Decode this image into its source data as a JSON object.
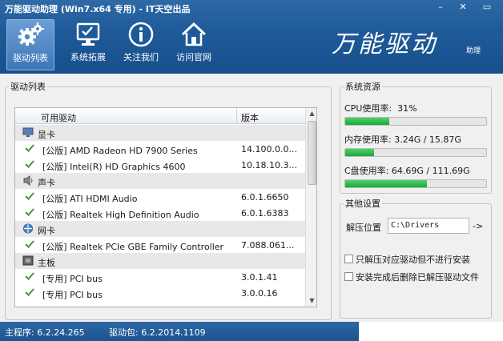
{
  "window": {
    "title": "万能驱动助理 (Win7.x64 专用) - IT天空出品",
    "min_glyph": "–",
    "close_glyph": "✕",
    "max_glyph": "▭"
  },
  "toolbar": {
    "items": [
      {
        "label": "驱动列表",
        "icon": "gear-icon",
        "active": true
      },
      {
        "label": "系统拓展",
        "icon": "monitor-icon",
        "active": false
      },
      {
        "label": "关注我们",
        "icon": "info-icon",
        "active": false
      },
      {
        "label": "访问官网",
        "icon": "home-icon",
        "active": false
      }
    ]
  },
  "brand": {
    "name": "万能驱动",
    "suffix": "助理"
  },
  "driver_panel": {
    "title": "驱动列表",
    "columns": {
      "name": "可用驱动",
      "version": "版本"
    },
    "rows": [
      {
        "type": "category",
        "name": "显卡",
        "icon": "display-card-icon"
      },
      {
        "type": "driver",
        "name": "[公版] AMD Radeon HD 7900 Series",
        "version": "14.100.0.0..."
      },
      {
        "type": "driver",
        "name": "[公版] Intel(R) HD Graphics 4600",
        "version": "10.18.10.3..."
      },
      {
        "type": "category",
        "name": "声卡",
        "icon": "speaker-icon"
      },
      {
        "type": "driver",
        "name": "[公版] ATI HDMI Audio",
        "version": "6.0.1.6650"
      },
      {
        "type": "driver",
        "name": "[公版] Realtek High Definition Audio",
        "version": "6.0.1.6383"
      },
      {
        "type": "category",
        "name": "网卡",
        "icon": "network-icon"
      },
      {
        "type": "driver",
        "name": "[公版] Realtek PCIe GBE Family Controller",
        "version": "7.088.061..."
      },
      {
        "type": "category",
        "name": "主板",
        "icon": "motherboard-icon"
      },
      {
        "type": "driver",
        "name": "[专用] PCI bus",
        "version": "3.0.1.41"
      },
      {
        "type": "driver",
        "name": "[专用] PCI bus",
        "version": "3.0.0.16"
      }
    ]
  },
  "system_resources": {
    "title": "系统资源",
    "cpu": {
      "label": "CPU使用率:",
      "value": "31%",
      "fraction": 0.31
    },
    "memory": {
      "label": "内存使用率:",
      "value": "3.24G / 15.87G",
      "fraction": 0.204
    },
    "disk": {
      "label": "C盘使用率:",
      "value": "64.69G / 111.69G",
      "fraction": 0.579
    }
  },
  "other_settings": {
    "title": "其他设置",
    "unzip_label": "解压位置",
    "unzip_path": "C:\\Drivers",
    "go_label": "->",
    "options": [
      {
        "label": "只解压对应驱动但不进行安装",
        "checked": false
      },
      {
        "label": "安装完成后删除已解压驱动文件",
        "checked": false
      }
    ]
  },
  "status": {
    "main_program": "主程序: 6.2.24.265",
    "driver_pack": "驱动包: 6.2.2014.1109"
  },
  "colors": {
    "header_blue": "#1f5a9a",
    "progress_green": "#19a63a",
    "check_green": "#3a9a3a"
  }
}
